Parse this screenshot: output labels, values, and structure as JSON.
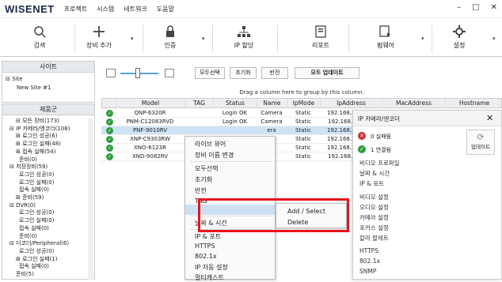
{
  "app": {
    "logo": "WISENET",
    "menu": [
      "프로젝트",
      "시스템",
      "네트워크",
      "도움말"
    ],
    "win_controls": [
      "–",
      "□",
      "✕"
    ]
  },
  "toolbar": [
    {
      "label": "검색",
      "icon": "search-icon"
    },
    {
      "label": "장비 추가",
      "icon": "plus-icon"
    },
    {
      "label": "인증",
      "icon": "lock-icon"
    },
    {
      "label": "IP 할당",
      "icon": "network-icon"
    },
    {
      "label": "리포트",
      "icon": "report-icon"
    },
    {
      "label": "펌웨어",
      "icon": "firmware-icon"
    },
    {
      "label": "설정",
      "icon": "gear-icon"
    }
  ],
  "site_panel": {
    "title": "사이트",
    "root": "Site",
    "child": "New Site #1"
  },
  "group_panel": {
    "title": "제품군",
    "tree": [
      "⊟ 모든 장비(173)",
      "⊟ IP 카메라/엔코더(108)",
      "⊞ 로그인 성공(6)",
      "⊞ 로그인 실패(48)",
      "⊞ 접속 실패(54)",
      "준비(0)",
      "⊟ 저장장비(59)",
      "로그인 성공(0)",
      "로그인 실패(0)",
      "접속 실패(0)",
      "⊞ 준비(59)",
      "⊟ DVR(0)",
      "로그인 성공(0)",
      "로그인 실패(0)",
      "접속 실패(0)",
      "준비(0)",
      "⊟ 디코더/Peripheral(6)",
      "로그인 성공(0)",
      "⊞ 로그인 실패(1)",
      "접속 실패(0)",
      "준비(5)"
    ]
  },
  "actions": {
    "select_all": "모두선택",
    "reset": "초기화",
    "invert": "반전",
    "update_all": "모두 업데이트"
  },
  "grid": {
    "drag_hint": "Drag a column here to group by this column.",
    "columns": [
      "Model",
      "TAG",
      "Status",
      "Name",
      "IpMode",
      "IpAddress",
      "MacAddress",
      "Hostname"
    ],
    "rows": [
      [
        "QNP-6320R",
        "",
        "Login OK",
        "Camera",
        "Static",
        "192.168.201.142",
        "",
        "0091"
      ],
      [
        "PNM-C12083RVD",
        "",
        "Login OK",
        "Camera",
        "Static",
        "192.168.201. 81",
        "",
        "VD-"
      ],
      [
        "PNF-9010RV",
        "",
        "",
        "era",
        "Static",
        "192.168.125.169",
        "",
        ""
      ],
      [
        "XNP-C9303RW",
        "",
        "",
        "era",
        "Static",
        "192.168.201.179",
        "",
        "-E4"
      ],
      [
        "XNO-6123R",
        "",
        "",
        "era",
        "Static",
        "192.168.201.123",
        "",
        "0091"
      ],
      [
        "XND-9082RV",
        "",
        "",
        "era",
        "Static",
        "192.168.201. 18",
        "",
        "0091"
      ]
    ]
  },
  "context_menu": {
    "items": [
      "라이브 뷰어",
      "장비 이름 변경",
      "모두선택",
      "초기화",
      "반전",
      "TAG",
      "날짜 & 시간",
      "IP & 포트",
      "HTTPS",
      "802.1x",
      "IP 자동 설정",
      "멀티캐스트"
    ],
    "sub": [
      "Add / Select",
      "Delete"
    ]
  },
  "cam_panel": {
    "title": "IP 카메라/엔코더",
    "failed": "0 실패됨",
    "connected": "1 연결됨",
    "update_btn": "업데이트",
    "items": [
      "비디오 프로파일",
      "날짜 & 시간",
      "IP & 포트",
      "비디오 설정",
      "오디오 설정",
      "카메라 설정",
      "포커스 설정",
      "칼라 팔레트",
      "HTTPS",
      "802.1x",
      "SNMP"
    ]
  },
  "colors": {
    "accent_green": "#2e9e3e",
    "highlight_red": "#e8141b",
    "failure_red": "#d62b2b",
    "selection_blue": "#cfe3f6"
  }
}
